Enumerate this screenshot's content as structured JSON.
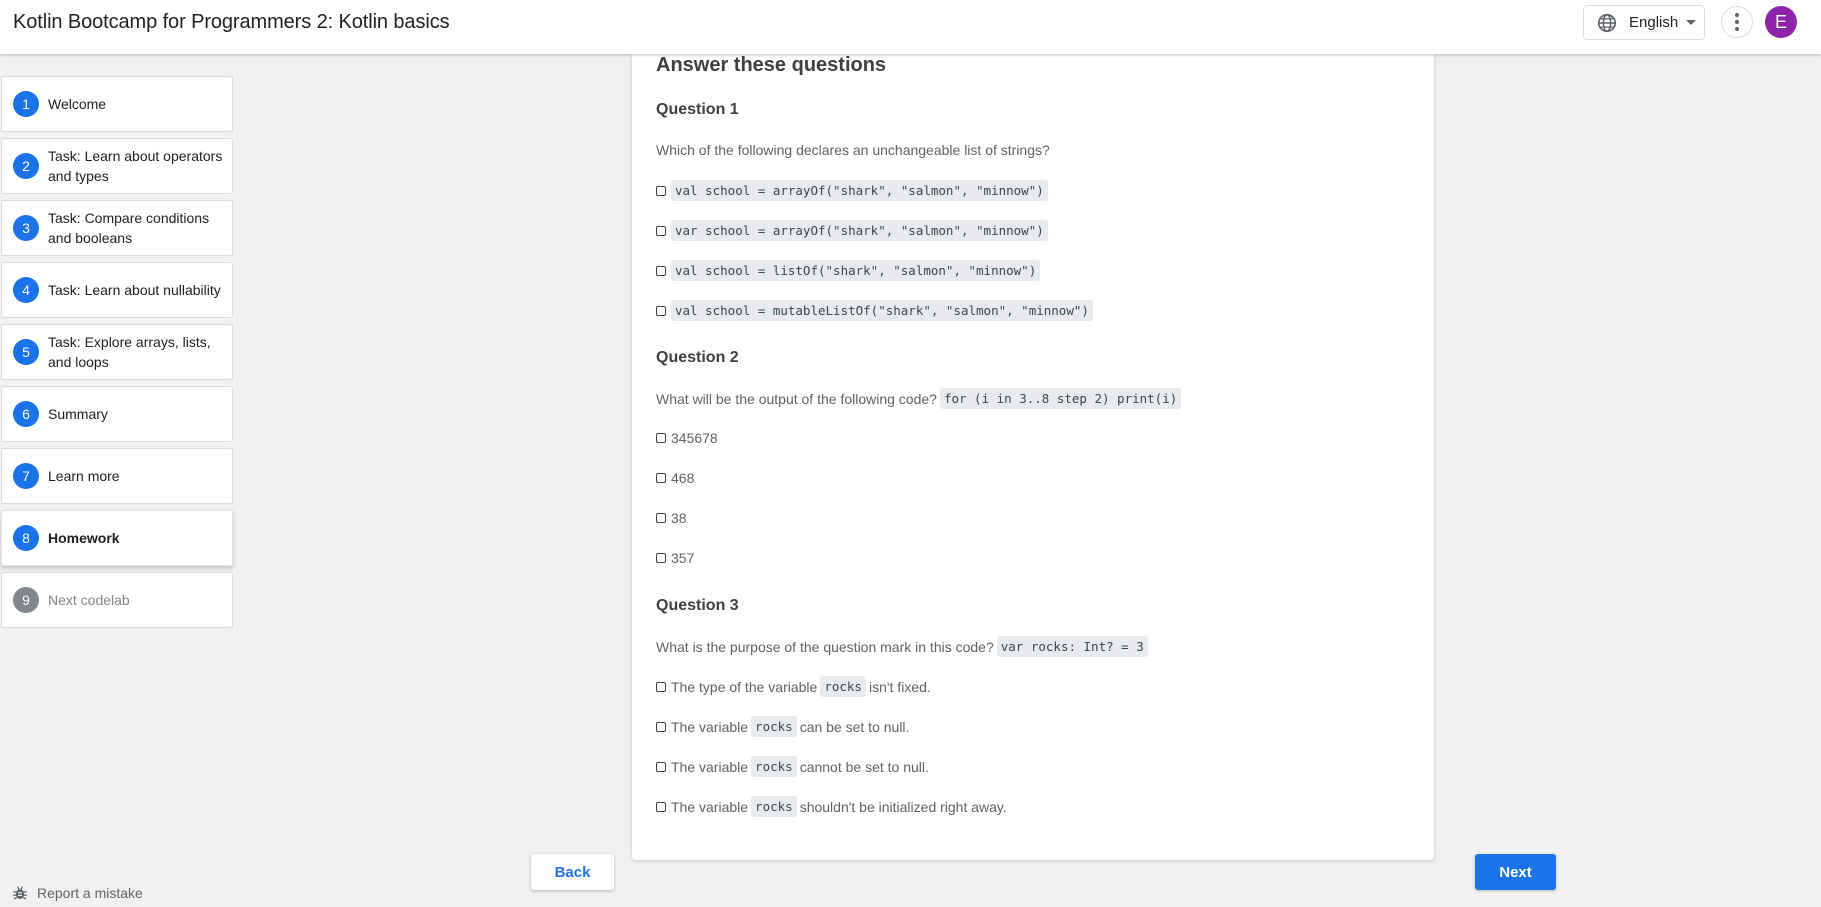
{
  "header": {
    "title": "Kotlin Bootcamp for Programmers 2: Kotlin basics",
    "language_label": "English",
    "avatar_initial": "E",
    "icons": [
      "globe-icon",
      "caret-down-icon",
      "more-vert-icon"
    ]
  },
  "steps": [
    {
      "num": "1",
      "label": "Welcome"
    },
    {
      "num": "2",
      "label": "Task: Learn about operators and types"
    },
    {
      "num": "3",
      "label": "Task: Compare conditions and booleans"
    },
    {
      "num": "4",
      "label": "Task: Learn about nullability"
    },
    {
      "num": "5",
      "label": "Task: Explore arrays, lists, and loops"
    },
    {
      "num": "6",
      "label": "Summary"
    },
    {
      "num": "7",
      "label": "Learn more"
    },
    {
      "num": "8",
      "label": "Homework",
      "active": true
    },
    {
      "num": "9",
      "label": "Next codelab",
      "disabled": true
    }
  ],
  "report_label": "Report a mistake",
  "content": {
    "heading": "Answer these questions",
    "q1": {
      "title": "Question 1",
      "text": "Which of the following declares an unchangeable list of strings?",
      "options": [
        "val school = arrayOf(\"shark\", \"salmon\", \"minnow\")",
        "var school = arrayOf(\"shark\", \"salmon\", \"minnow\")",
        "val school = listOf(\"shark\", \"salmon\", \"minnow\")",
        "val school = mutableListOf(\"shark\", \"salmon\", \"minnow\")"
      ]
    },
    "q2": {
      "title": "Question 2",
      "text": "What will be the output of the following code?",
      "code": "for (i in 3..8 step 2) print(i)",
      "options": [
        "345678",
        "468",
        "38",
        "357"
      ]
    },
    "q3": {
      "title": "Question 3",
      "text": "What is the purpose of the question mark in this code?",
      "code": "var rocks: Int? = 3",
      "options": [
        {
          "before": "The type of the variable",
          "code": "rocks",
          "after": "isn't fixed."
        },
        {
          "before": "The variable",
          "code": "rocks",
          "after": "can be set to null."
        },
        {
          "before": "The variable",
          "code": "rocks",
          "after": "cannot be set to null."
        },
        {
          "before": "The variable",
          "code": "rocks",
          "after": "shouldn't be initialized right away."
        }
      ]
    }
  },
  "nav": {
    "back_label": "Back",
    "next_label": "Next"
  },
  "colors": {
    "primary": "#1a73e8",
    "avatar": "#8e24aa",
    "background": "#f1f1f1"
  }
}
